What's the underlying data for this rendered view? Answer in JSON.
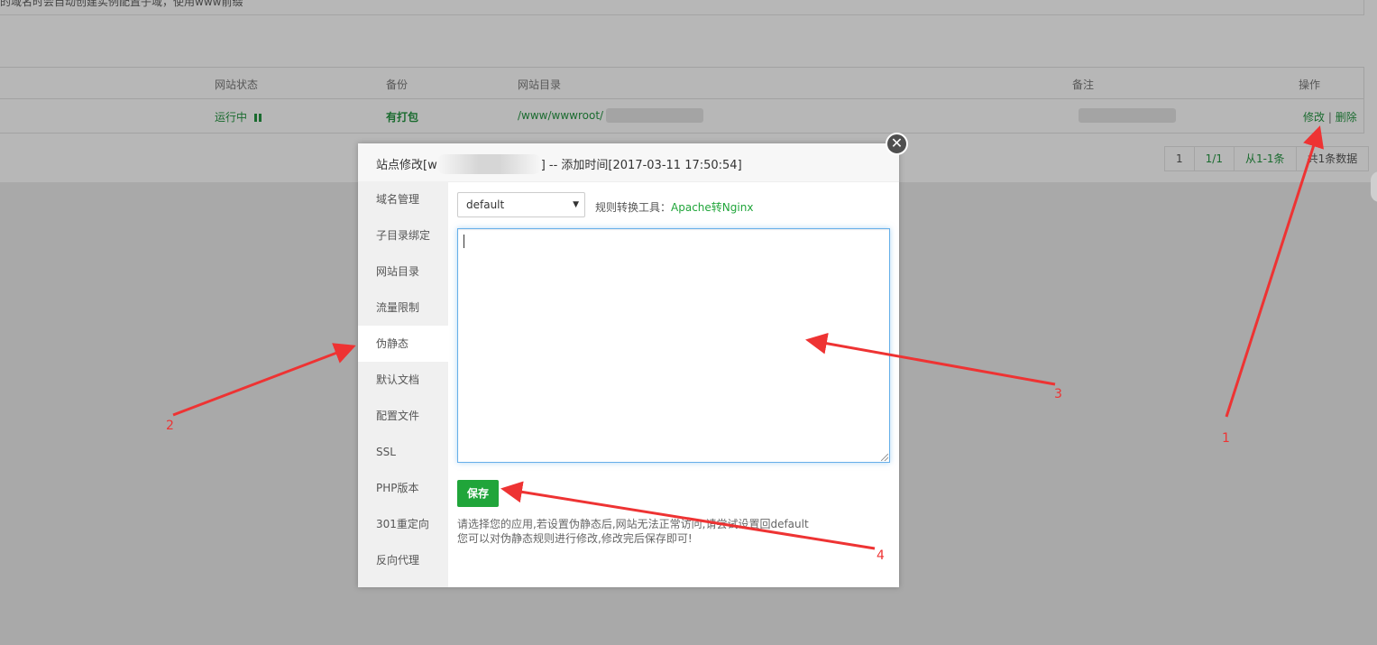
{
  "top_notice": "的域名时会自动创建实例配置子域，使用www前缀",
  "table": {
    "headers": {
      "status": "网站状态",
      "backup": "备份",
      "dir": "网站目录",
      "note": "备注",
      "ops": "操作"
    },
    "row": {
      "status": "运行中",
      "backup": "有打包",
      "dir": "/www/wwwroot/",
      "edit": "修改",
      "sep": "|",
      "delete": "删除"
    }
  },
  "pager": [
    "1",
    "1/1",
    "从1-1条",
    "共1条数据"
  ],
  "modal": {
    "title_prefix": "站点修改[w",
    "title_suffix": "] -- 添加时间[2017-03-11 17:50:54]",
    "close_glyph": "✕",
    "nav": [
      "域名管理",
      "子目录绑定",
      "网站目录",
      "流量限制",
      "伪静态",
      "默认文档",
      "配置文件",
      "SSL",
      "PHP版本",
      "301重定向",
      "反向代理"
    ],
    "active_nav_index": 4,
    "select_value": "default",
    "tool_label": "规则转换工具：",
    "tool_link": "Apache转Nginx",
    "textarea_value": "",
    "save_label": "保存",
    "tip1": "请选择您的应用,若设置伪静态后,网站无法正常访问,请尝试设置回default",
    "tip2": "您可以对伪静态规则进行修改,修改完后保存即可!"
  },
  "annotations": [
    "1",
    "2",
    "3",
    "4"
  ],
  "colors": {
    "accent": "#20a53a",
    "annotation": "#ee3333",
    "overlay": "#a9a9a9"
  }
}
